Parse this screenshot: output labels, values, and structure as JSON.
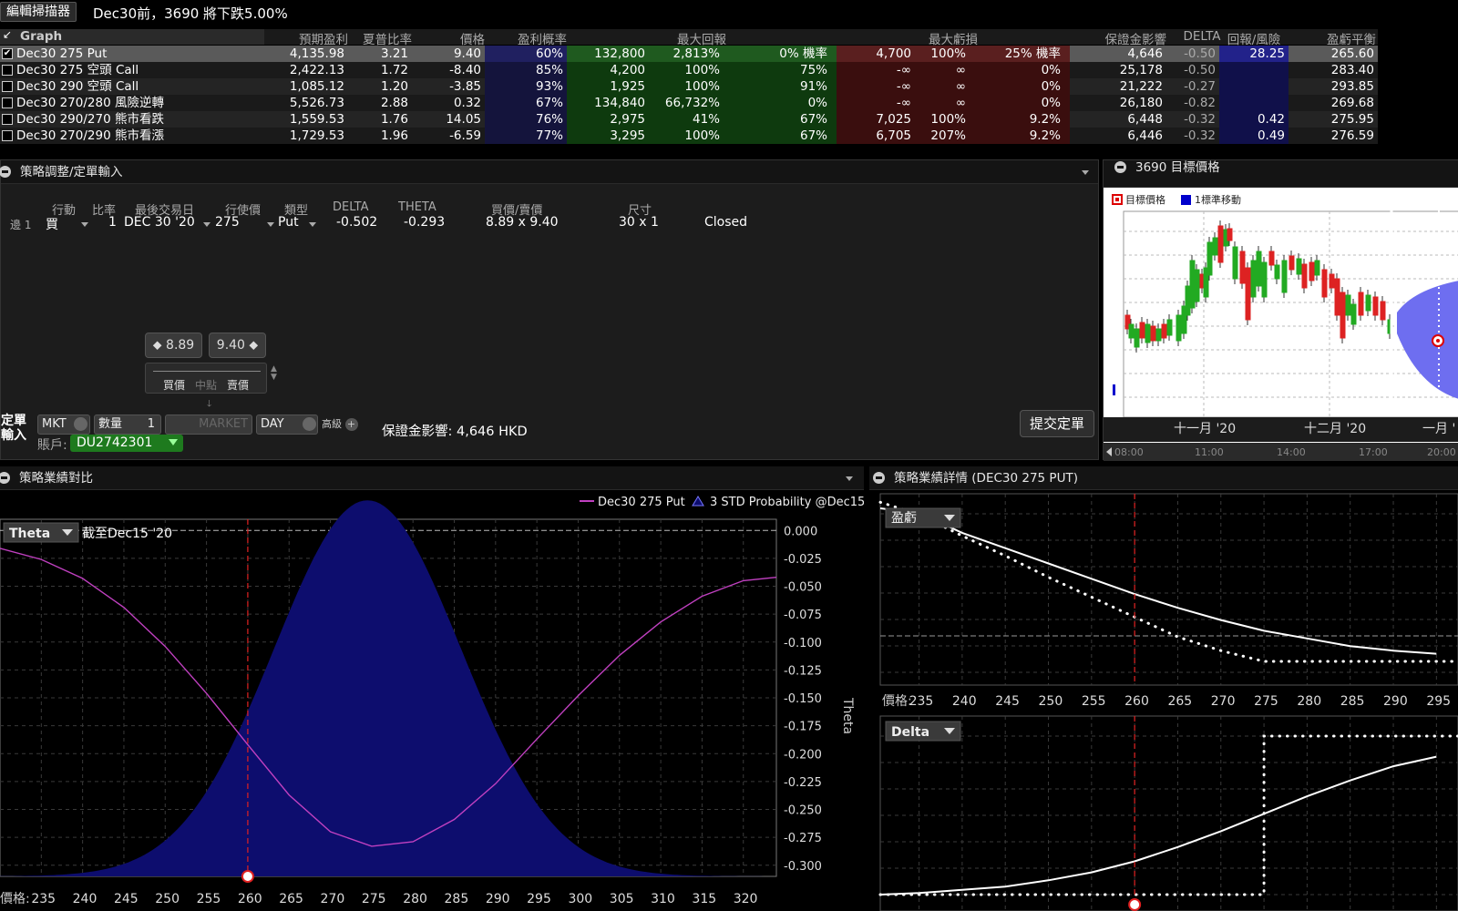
{
  "toolbar": {
    "edit_label": "編輯掃描器",
    "scenario": "Dec30前，3690 將下跌5.00%"
  },
  "scanner": {
    "graph_label": "Graph",
    "headers": {
      "expected_pl": "預期盈利",
      "sharpe": "夏普比率",
      "price": "價格",
      "prob": "盈利概率",
      "max_return": "最大回報",
      "max_loss": "最大虧損",
      "margin": "保證金影響",
      "delta": "DELTA",
      "rr": "回報/風險",
      "breakeven": "盈虧平衡"
    },
    "rows": [
      {
        "checked": true,
        "name": "Dec30 275 Put",
        "expected_pl": "4,135.98",
        "sharpe": "3.21",
        "price": "9.40",
        "prob": "60%",
        "ret_amt": "132,800",
        "ret_pct": "2,813%",
        "ret_prob": "0% 機率",
        "loss_amt": "4,700",
        "loss_pct": "100%",
        "loss_prob": "25% 機率",
        "margin": "4,646",
        "delta": "-0.50",
        "rr": "28.25",
        "breakeven": "265.60"
      },
      {
        "checked": false,
        "name": "Dec30 275 空頭 Call",
        "expected_pl": "2,422.13",
        "sharpe": "1.72",
        "price": "-8.40",
        "prob": "85%",
        "ret_amt": "4,200",
        "ret_pct": "100%",
        "ret_prob": "75%",
        "loss_amt": "-∞",
        "loss_pct": "∞",
        "loss_prob": "0%",
        "margin": "25,178",
        "delta": "-0.50",
        "rr": "",
        "breakeven": "283.40"
      },
      {
        "checked": false,
        "name": "Dec30 290 空頭 Call",
        "expected_pl": "1,085.12",
        "sharpe": "1.20",
        "price": "-3.85",
        "prob": "93%",
        "ret_amt": "1,925",
        "ret_pct": "100%",
        "ret_prob": "91%",
        "loss_amt": "-∞",
        "loss_pct": "∞",
        "loss_prob": "0%",
        "margin": "21,222",
        "delta": "-0.27",
        "rr": "",
        "breakeven": "293.85"
      },
      {
        "checked": false,
        "name": "Dec30 270/280 風險逆轉",
        "expected_pl": "5,526.73",
        "sharpe": "2.88",
        "price": "0.32",
        "prob": "67%",
        "ret_amt": "134,840",
        "ret_pct": "66,732%",
        "ret_prob": "0%",
        "loss_amt": "-∞",
        "loss_pct": "∞",
        "loss_prob": "0%",
        "margin": "26,180",
        "delta": "-0.82",
        "rr": "",
        "breakeven": "269.68"
      },
      {
        "checked": false,
        "name": "Dec30 290/270 熊市看跌",
        "expected_pl": "1,559.53",
        "sharpe": "1.76",
        "price": "14.05",
        "prob": "76%",
        "ret_amt": "2,975",
        "ret_pct": "41%",
        "ret_prob": "67%",
        "loss_amt": "7,025",
        "loss_pct": "100%",
        "loss_prob": "9.2%",
        "margin": "6,448",
        "delta": "-0.32",
        "rr": "0.42",
        "breakeven": "275.95"
      },
      {
        "checked": false,
        "name": "Dec30 270/290 熊市看漲",
        "expected_pl": "1,729.53",
        "sharpe": "1.96",
        "price": "-6.59",
        "prob": "77%",
        "ret_amt": "3,295",
        "ret_pct": "100%",
        "ret_prob": "67%",
        "loss_amt": "6,705",
        "loss_pct": "207%",
        "loss_prob": "9.2%",
        "margin": "6,446",
        "delta": "-0.32",
        "rr": "0.49",
        "breakeven": "276.59"
      }
    ]
  },
  "strategy": {
    "title": "策略調整/定單輸入",
    "cols": {
      "action": "行動",
      "ratio": "比率",
      "last_trade": "最後交易日",
      "strike": "行使價",
      "type": "類型",
      "delta": "DELTA",
      "theta": "THETA",
      "bidask": "買價/賣價",
      "size": "尺寸"
    },
    "leg": {
      "label": "邊 1",
      "action": "買",
      "ratio": "1",
      "last_trade": "DEC 30 '20",
      "strike": "275",
      "type": "Put",
      "delta": "-0.502",
      "theta": "-0.293",
      "bidask": "8.89 x 9.40",
      "size": "30 x 1",
      "status": "Closed"
    },
    "bid_box": "8.89",
    "ask_box": "9.40",
    "slider_labels": {
      "bid": "買價",
      "mid": "中點",
      "ask": "賣價"
    },
    "order": {
      "label_line1": "定單",
      "label_line2": "輸入",
      "type": "MKT",
      "qty_label": "數量",
      "qty": "1",
      "price": "MARKET",
      "tif": "DAY",
      "adv": "高級",
      "account_label": "賬戶:",
      "account": "DU2742301",
      "margin": "保證金影響: 4,646 HKD",
      "submit": "提交定單"
    }
  },
  "target": {
    "title": "3690 目標價格",
    "legend": {
      "target": "目標價格",
      "std": "1標準移動"
    },
    "months": [
      "十一月 '20",
      "十二月 '20",
      "一月 '"
    ],
    "times": [
      "08:00",
      "11:00",
      "14:00",
      "17:00",
      "20:00"
    ]
  },
  "performance": {
    "title": "策略業績對比",
    "legend_put": "Dec30 275 Put",
    "legend_prob": "3 STD Probability @Dec15",
    "metric": "Theta",
    "as_of": "截至Dec15 '20",
    "price_label": "價格:",
    "y_axis_label": "Theta"
  },
  "detail": {
    "title": "策略業績詳情 (DEC30 275 PUT)",
    "pl_label": "盈虧",
    "delta_label": "Delta",
    "price_label": "價格:"
  },
  "colors": {
    "theta_line": "#c040c0",
    "prob_fill": "#0d0d6e",
    "red_marker": "#e02020",
    "green_btn": "#1e7a1e",
    "accent_blue": "#0000cc"
  },
  "chart_data": [
    {
      "type": "line",
      "title": "策略業績對比",
      "ylabel": "Theta",
      "xlabel": "價格:",
      "x": [
        235,
        240,
        245,
        250,
        255,
        260,
        265,
        270,
        275,
        280,
        285,
        290,
        295,
        300,
        305,
        310,
        315,
        320
      ],
      "xlim": [
        230,
        324
      ],
      "ylim": [
        -0.31,
        0.01
      ],
      "yticks": [
        0.0,
        -0.025,
        -0.05,
        -0.075,
        -0.1,
        -0.125,
        -0.15,
        -0.175,
        -0.2,
        -0.225,
        -0.25,
        -0.275,
        -0.3
      ],
      "series": [
        {
          "name": "Dec30 275 Put",
          "values": [
            -0.026,
            -0.043,
            -0.069,
            -0.104,
            -0.146,
            -0.192,
            -0.237,
            -0.27,
            -0.283,
            -0.279,
            -0.259,
            -0.227,
            -0.187,
            -0.148,
            -0.112,
            -0.082,
            -0.059,
            -0.045
          ]
        },
        {
          "name": "3 STD Probability @Dec15",
          "fill": true,
          "mean": 274.5,
          "sd": 11.3,
          "peak_y": 0.027
        }
      ],
      "current_price": 260
    },
    {
      "type": "line",
      "title": "盈虧",
      "xlabel": "價格:",
      "x": [
        235,
        240,
        245,
        250,
        255,
        260,
        265,
        270,
        275,
        280,
        285,
        290,
        295
      ],
      "series": [
        {
          "name": "now",
          "values": [
            0.97,
            0.84,
            0.74,
            0.64,
            0.54,
            0.44,
            0.35,
            0.27,
            0.2,
            0.15,
            0.1,
            0.07,
            0.05
          ]
        },
        {
          "name": "expiry",
          "style": "dotted",
          "values": [
            0.96,
            0.82,
            0.69,
            0.55,
            0.42,
            0.29,
            0.16,
            0.07,
            0.0,
            0.0,
            0.0,
            0.0,
            0.0
          ]
        }
      ],
      "current_price": 260
    },
    {
      "type": "line",
      "title": "Delta",
      "xlabel": "價格:",
      "x": [
        235,
        240,
        245,
        250,
        255,
        260,
        265,
        270,
        275,
        280,
        285,
        290,
        295
      ],
      "series": [
        {
          "name": "now",
          "values": [
            0.01,
            0.03,
            0.05,
            0.09,
            0.14,
            0.21,
            0.3,
            0.4,
            0.51,
            0.62,
            0.72,
            0.81,
            0.87
          ]
        },
        {
          "name": "expiry",
          "style": "dotted",
          "values": [
            0.0,
            0.0,
            0.0,
            0.0,
            0.0,
            0.0,
            0.0,
            0.0,
            1.0,
            1.0,
            1.0,
            1.0,
            1.0
          ]
        }
      ],
      "current_price": 260
    }
  ]
}
